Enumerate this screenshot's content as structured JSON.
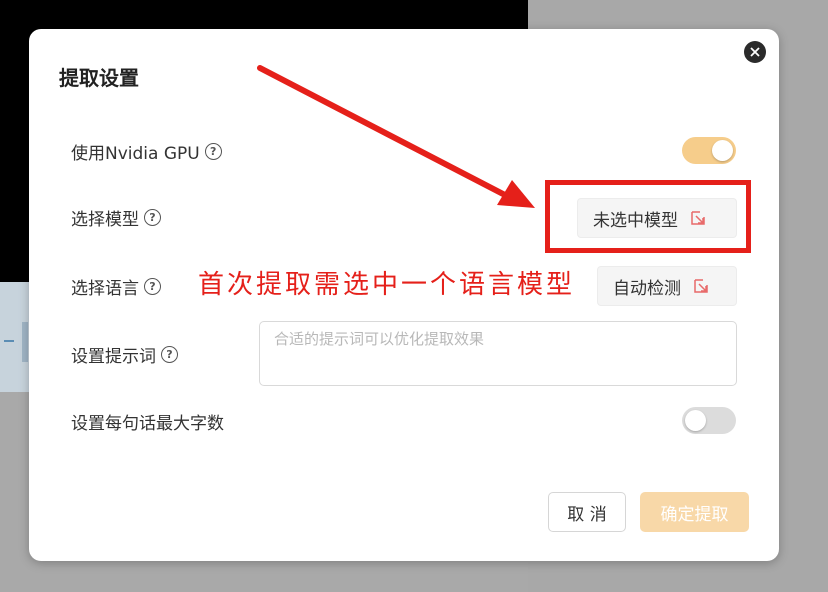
{
  "dialog": {
    "title": "提取设置",
    "close_glyph": "✕"
  },
  "rows": {
    "gpu": {
      "label": "使用Nvidia GPU",
      "help": "?",
      "enabled": true
    },
    "model": {
      "label": "选择模型",
      "help": "?",
      "value": "未选中模型",
      "icon": "external-select-icon"
    },
    "language": {
      "label": "选择语言",
      "help": "?",
      "value": "自动检测",
      "icon": "external-select-icon"
    },
    "prompt": {
      "label": "设置提示词",
      "help": "?",
      "placeholder": "合适的提示词可以优化提取效果",
      "value": ""
    },
    "max_chars": {
      "label": "设置每句话最大字数",
      "enabled": false
    }
  },
  "footer": {
    "cancel_label": "取 消",
    "confirm_label": "确定提取"
  },
  "annotation": {
    "text": "首次提取需选中一个语言模型",
    "color": "#e5201a"
  },
  "colors": {
    "accent": "#f6cd8b",
    "confirm_disabled": "#f8d8a8",
    "toggle_off": "#dcdcdc",
    "icon_red": "#e86a6a"
  }
}
